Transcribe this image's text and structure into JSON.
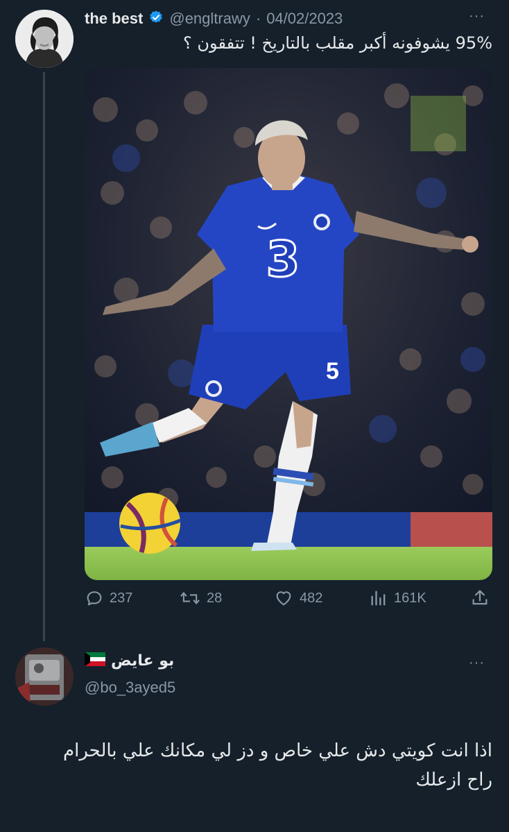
{
  "tweet": {
    "name": "the best",
    "handle": "@engltrawy",
    "date": "04/02/2023",
    "separator": "·",
    "more": "···",
    "text": "95% يشوفونه أكبر مقلب بالتاريخ ! تتفقون ؟",
    "media": {
      "shirt_number": "5",
      "sponsor_logo": "3"
    },
    "stats": {
      "replies": "237",
      "retweets": "28",
      "likes": "482",
      "views": "161K"
    }
  },
  "reply": {
    "name": "بو عايض",
    "flag": "kuwait-flag",
    "handle": "@bo_3ayed5",
    "more": "···",
    "text_line1": "اذا انت كويتي دش علي خاص و دز لي مكانك علي بالحرام",
    "text_line2": "راح ازعلك"
  },
  "colors": {
    "background": "#15202b",
    "verified": "#1d9bf0",
    "muted": "#8b98a5",
    "jersey": "#1f3fb8",
    "pitch": "#8bbf4f"
  }
}
